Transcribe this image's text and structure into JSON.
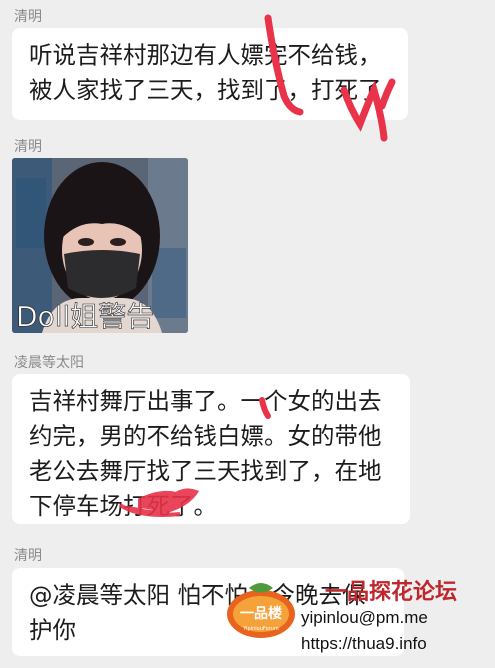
{
  "messages": [
    {
      "sender": "清明",
      "lines": [
        "听说吉祥村那边有人嫖完不给钱，",
        "被人家找了三天，找到了，打死了"
      ]
    },
    {
      "sender": "清明",
      "image": {
        "caption": "Doll姐警告"
      }
    },
    {
      "sender": "凌晨等太阳",
      "lines": [
        "吉祥村舞厅出事了。一个女的出去",
        "约完，男的不给钱白嫖。女的带他",
        "老公去舞厅找了三天找到了，在地",
        "下停车场打死了。"
      ]
    },
    {
      "sender": "清明",
      "lines": [
        "@凌晨等太阳  怕不怕，今晚去保",
        "护你"
      ]
    }
  ],
  "watermark": {
    "forum_name": "一品探花论坛",
    "logo_text": "一品楼",
    "logo_subtext": "YipinlouForum",
    "email": "yipinlou@pm.me",
    "url": "https://thua9.info"
  },
  "colors": {
    "background": "#eeeeee",
    "bubble": "#ffffff",
    "sender": "#8a8a8a",
    "scribble": "#e8334a",
    "forum_name": "#c0272d"
  }
}
